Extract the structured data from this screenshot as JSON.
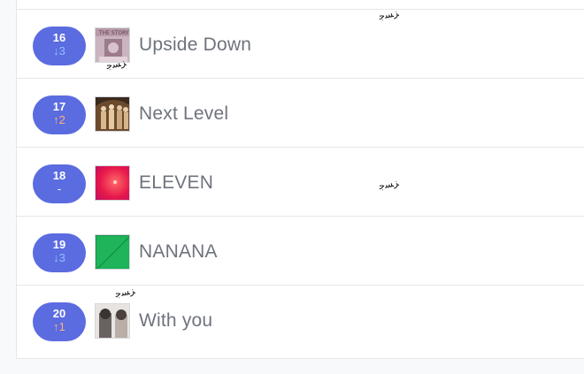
{
  "chart_list": {
    "rows": [
      {
        "rank": "16",
        "change": "↓3",
        "direction": "down",
        "title": "Upside Down"
      },
      {
        "rank": "17",
        "change": "↑2",
        "direction": "up",
        "title": "Next Level"
      },
      {
        "rank": "18",
        "change": "-",
        "direction": "same",
        "title": "ELEVEN"
      },
      {
        "rank": "19",
        "change": "↓3",
        "direction": "down",
        "title": "NANANA"
      },
      {
        "rank": "20",
        "change": "↑1",
        "direction": "up",
        "title": "With you"
      }
    ]
  },
  "colors": {
    "rank_pill": "#5b6be0",
    "change_down": "#8ec1ff",
    "change_up": "#ffb37a",
    "title_text": "#6e737d"
  }
}
